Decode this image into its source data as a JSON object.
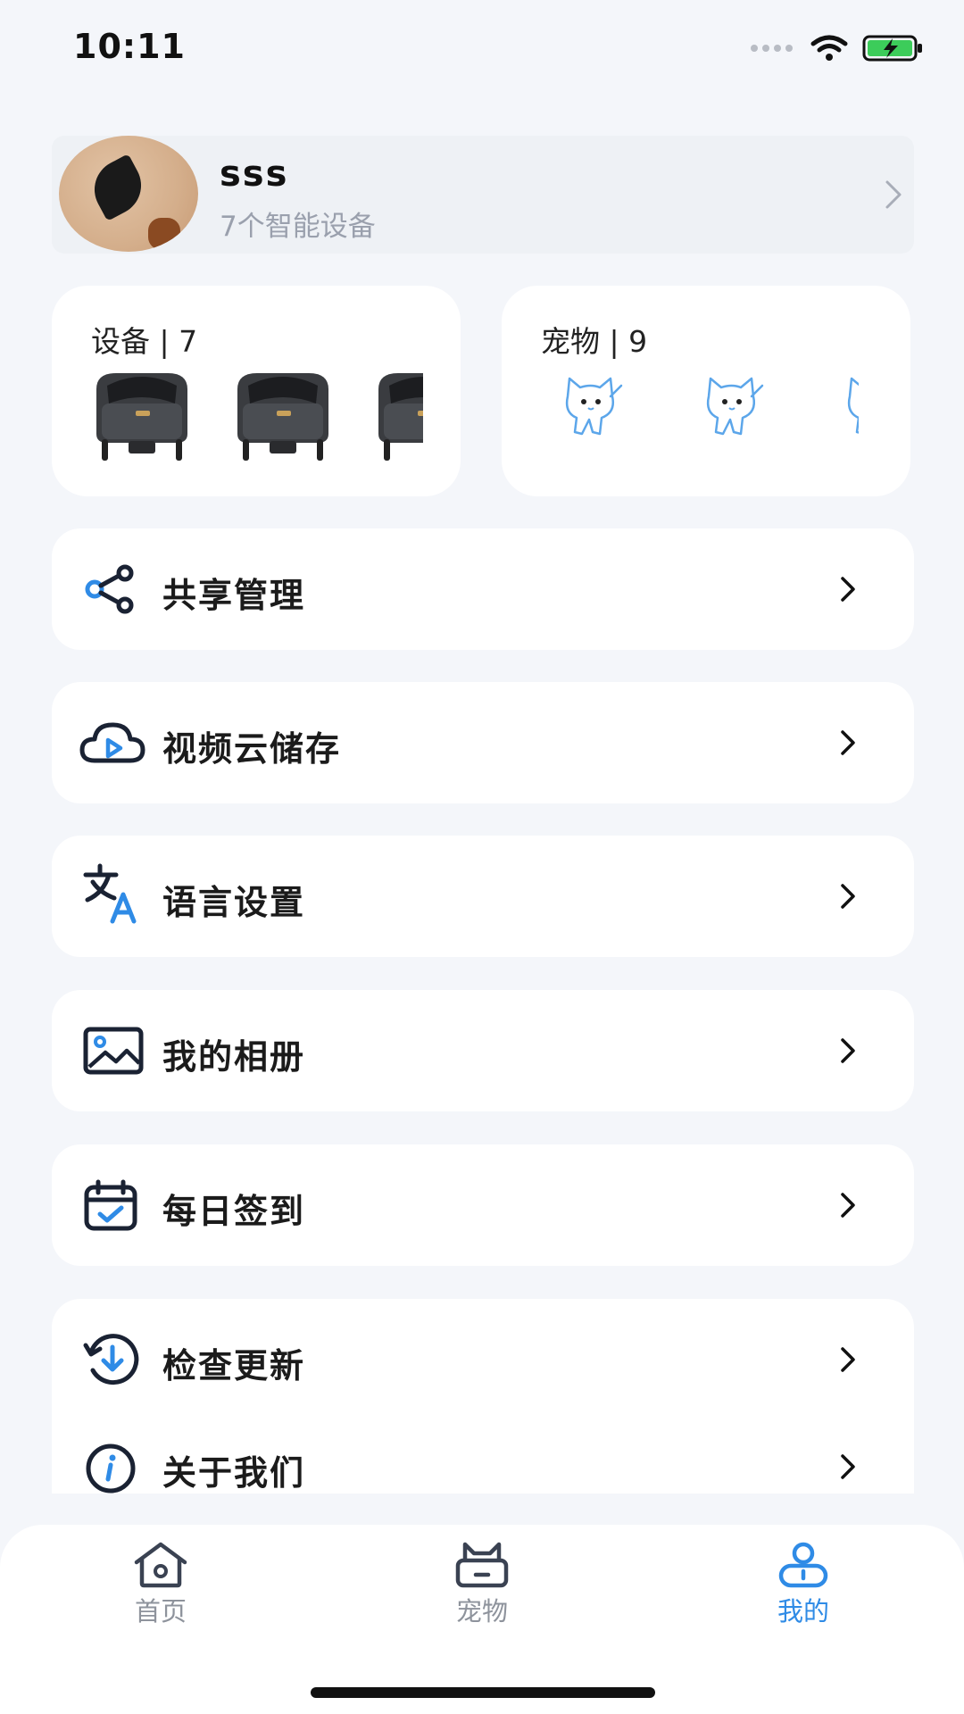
{
  "status_bar": {
    "time": "10:11"
  },
  "profile": {
    "name": "sss",
    "subtitle": "7个智能设备"
  },
  "stats": {
    "devices": {
      "title": "设备 | 7"
    },
    "pets": {
      "title": "宠物 | 9"
    }
  },
  "menu": [
    {
      "label": "共享管理",
      "icon": "share-icon"
    },
    {
      "label": "视频云储存",
      "icon": "cloud-video-icon"
    },
    {
      "label": "语言设置",
      "icon": "translate-icon"
    },
    {
      "label": "我的相册",
      "icon": "photo-album-icon"
    },
    {
      "label": "每日签到",
      "icon": "calendar-check-icon"
    },
    {
      "label": "检查更新",
      "icon": "update-icon"
    },
    {
      "label": "关于我们",
      "icon": "info-icon"
    }
  ],
  "tabbar": {
    "items": [
      {
        "label": "首页",
        "icon": "home-icon"
      },
      {
        "label": "宠物",
        "icon": "cat-icon"
      },
      {
        "label": "我的",
        "icon": "user-icon",
        "active": true
      }
    ]
  },
  "colors": {
    "accent": "#2f8be6",
    "background": "#f4f6fa",
    "card": "#ffffff",
    "text_secondary": "#9aa0ad"
  }
}
